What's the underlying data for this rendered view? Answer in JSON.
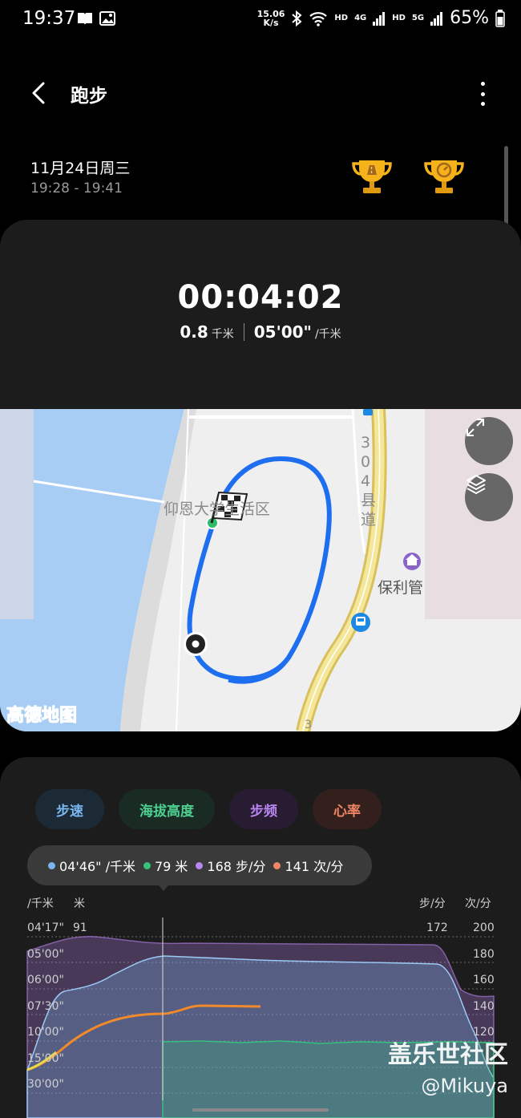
{
  "status_bar": {
    "time": "19:37",
    "net_speed_value": "15.06",
    "net_speed_unit": "K/s",
    "hd1": "HD",
    "net1": "4G",
    "hd2": "HD",
    "net2": "5G",
    "battery": "65%"
  },
  "header": {
    "title": "跑步"
  },
  "session": {
    "date": "11月24日周三",
    "time_range": "19:28 - 19:41",
    "duration": "00:04:02",
    "distance_value": "0.8",
    "distance_unit": "千米",
    "pace_value": "05'00\"",
    "pace_unit": "/千米"
  },
  "map": {
    "labels": {
      "community": "仰恩大学生活区",
      "road_chars": [
        "3",
        "0",
        "4",
        "县",
        "道"
      ],
      "poi": "保利管",
      "road_bottom": "3"
    },
    "provider": "高德地图"
  },
  "chart": {
    "tabs": [
      {
        "label": "步速",
        "key": "pace"
      },
      {
        "label": "海拔高度",
        "key": "alt"
      },
      {
        "label": "步频",
        "key": "cad"
      },
      {
        "label": "心率",
        "key": "hr"
      }
    ],
    "tooltip": [
      {
        "value": "04'46\" /千米",
        "color": "#7ab6ef"
      },
      {
        "value": "79 米",
        "color": "#35c27a"
      },
      {
        "value": "168 步/分",
        "color": "#b884ef"
      },
      {
        "value": "141 次/分",
        "color": "#f08466"
      }
    ],
    "left_axis_units": [
      "/千米",
      "米"
    ],
    "right_axis_units": [
      "步/分",
      "次/分"
    ],
    "pace_ticks": [
      "04'17\"",
      "05'00\"",
      "06'00\"",
      "07'30\"",
      "10'00\"",
      "15'00\"",
      "30'00\""
    ],
    "altitude_tick": "91",
    "cadence_tick": "172",
    "hr_ticks": [
      "200",
      "180",
      "160",
      "140",
      "120"
    ],
    "colors": {
      "pace": "#7ab6ef",
      "altitude": "#35c27a",
      "cadence": "#b884ef",
      "hr": "#f08466"
    }
  },
  "watermark": {
    "line1": "盖乐世社区",
    "line2": "@Mikuya"
  }
}
